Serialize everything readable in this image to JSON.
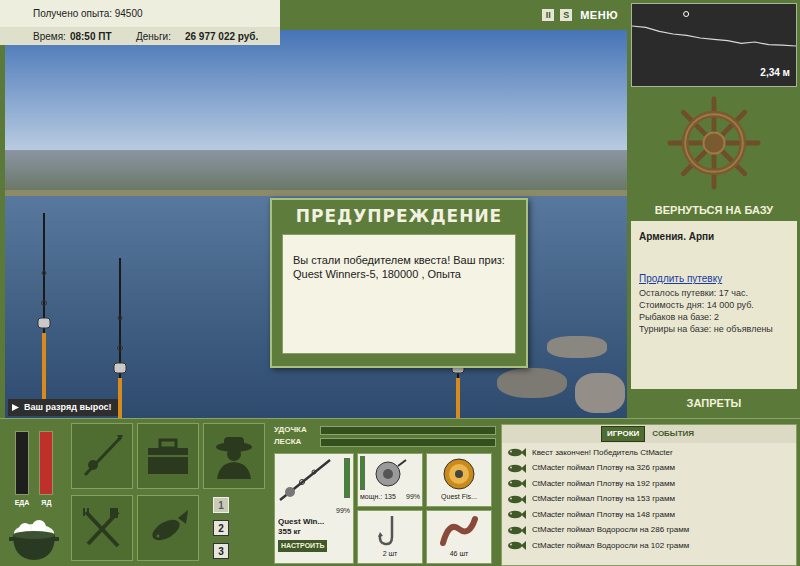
{
  "hud": {
    "experience": "Получено опыта: 94500",
    "time_label": "Время:",
    "time": "08:50 ПТ",
    "money_label": "Деньги:",
    "money": "26 977 022 руб."
  },
  "top_controls": [
    {
      "label": "II"
    },
    {
      "label": "S"
    },
    {
      "label": "МЕНЮ"
    }
  ],
  "depth": {
    "reading": "2,34 м",
    "profile": [
      0.9,
      1.0,
      1.3,
      1.5,
      1.6,
      1.8,
      1.9,
      2.0,
      2.2,
      2.1,
      2.3,
      2.34,
      2.4
    ],
    "boat_position": 0.33
  },
  "return_button": "ВЕРНУТЬСЯ НА БАЗУ",
  "base": {
    "title": "Армения. Арпи",
    "link": "Продлить путевку",
    "lines": [
      "Осталось путевки: 17 час.",
      "Стоимость дня: 14 000 руб.",
      "Рыбаков на базе: 2",
      "Турниры на базе: не объявлены"
    ]
  },
  "bans_button": "ЗАПРЕТЫ",
  "dialog": {
    "title": "ПРЕДУПРЕЖДЕНИЕ",
    "text": "Вы стали победителем квеста! Ваш приз: Quest Winners-5, 180000 , Опыта"
  },
  "badge": "Ваш разряд вырос!",
  "gauges": [
    {
      "label": "ЕДА",
      "level": 0.0,
      "color": "#3a3a3a"
    },
    {
      "label": "ЯД",
      "level": 1.0,
      "color": "#c0302a"
    }
  ],
  "pages": [
    {
      "label": "1",
      "selected": true
    },
    {
      "label": "2",
      "selected": false
    },
    {
      "label": "3",
      "selected": false
    }
  ],
  "bars": [
    {
      "label": "УДОЧКА",
      "level": 0.0
    },
    {
      "label": "ЛЕСКА",
      "level": 0.0
    }
  ],
  "slots": {
    "rod": {
      "name": "Quest Win...",
      "reading": "355 кг",
      "wear": "99%",
      "level": 0.99,
      "button": "НАСТРОИТЬ"
    },
    "reel": {
      "power": "мощн.: 135",
      "wear": "99%",
      "level": 0.99
    },
    "line": {
      "name": "Quest Fis..."
    },
    "hook": {
      "count": "2 шт"
    },
    "bait": {
      "count": "46 шт"
    }
  },
  "chat": {
    "tabs": [
      {
        "label": "ИГРОКИ",
        "selected": true
      },
      {
        "label": "СОБЫТИЯ",
        "selected": false
      }
    ],
    "messages": [
      "Квест закончен! Победитель CtMacter",
      "CtMacter поймал Плотву на 326 грамм",
      "CtMacter поймал Плотву на 192 грамм",
      "CtMacter поймал Плотву на 153 грамм",
      "CtMacter поймал Плотву на 148 грамм",
      "CtMacter поймал Водоросли на 286 грамм",
      "CtMacter поймал Водоросли на 102 грамм"
    ]
  }
}
